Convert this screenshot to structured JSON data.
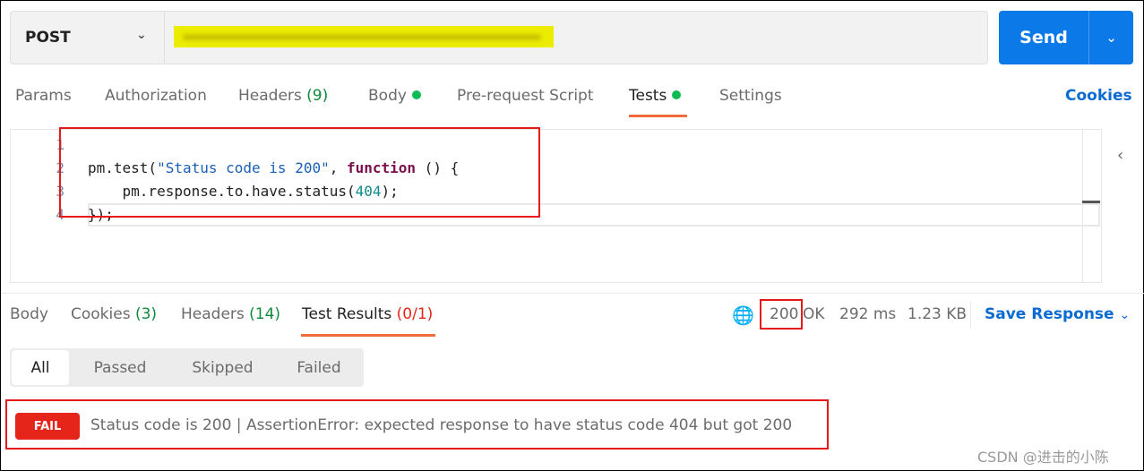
{
  "request": {
    "method": "POST",
    "send_label": "Send"
  },
  "tabs": [
    {
      "label": "Params"
    },
    {
      "label": "Authorization"
    },
    {
      "label": "Headers",
      "count": "(9)"
    },
    {
      "label": "Body"
    },
    {
      "label": "Pre-request Script"
    },
    {
      "label": "Tests"
    },
    {
      "label": "Settings"
    }
  ],
  "cookies_label": "Cookies",
  "editor": {
    "line_numbers": [
      "1",
      "2",
      "3",
      "4"
    ],
    "line1": {
      "a": "pm.test(",
      "b": "\"Status code is 200\"",
      "c": ", ",
      "d": "function",
      "e": " () {"
    },
    "line2": {
      "a": "    pm.response.to.have.status(",
      "b": "404",
      "c": ");"
    },
    "line3": "});"
  },
  "response": {
    "tabs": [
      {
        "label": "Body"
      },
      {
        "label": "Cookies",
        "count": "(3)"
      },
      {
        "label": "Headers",
        "count": "(14)"
      },
      {
        "label": "Test Results",
        "count": "(0/1)"
      }
    ],
    "status_code": "200",
    "status_text": "OK",
    "time": "292 ms",
    "size": "1.23 KB",
    "save_label": "Save Response"
  },
  "filters": [
    "All",
    "Passed",
    "Skipped",
    "Failed"
  ],
  "result": {
    "badge": "FAIL",
    "text": "Status code is 200 | AssertionError: expected response to have status code 404 but got 200"
  },
  "watermark": "CSDN @进击的小陈",
  "colors": {
    "accent": "#0b7ae8",
    "active_tab": "#f26b3a",
    "fail": "#e5241a",
    "success": "#0d8a3a",
    "annotation": "#e61919"
  }
}
